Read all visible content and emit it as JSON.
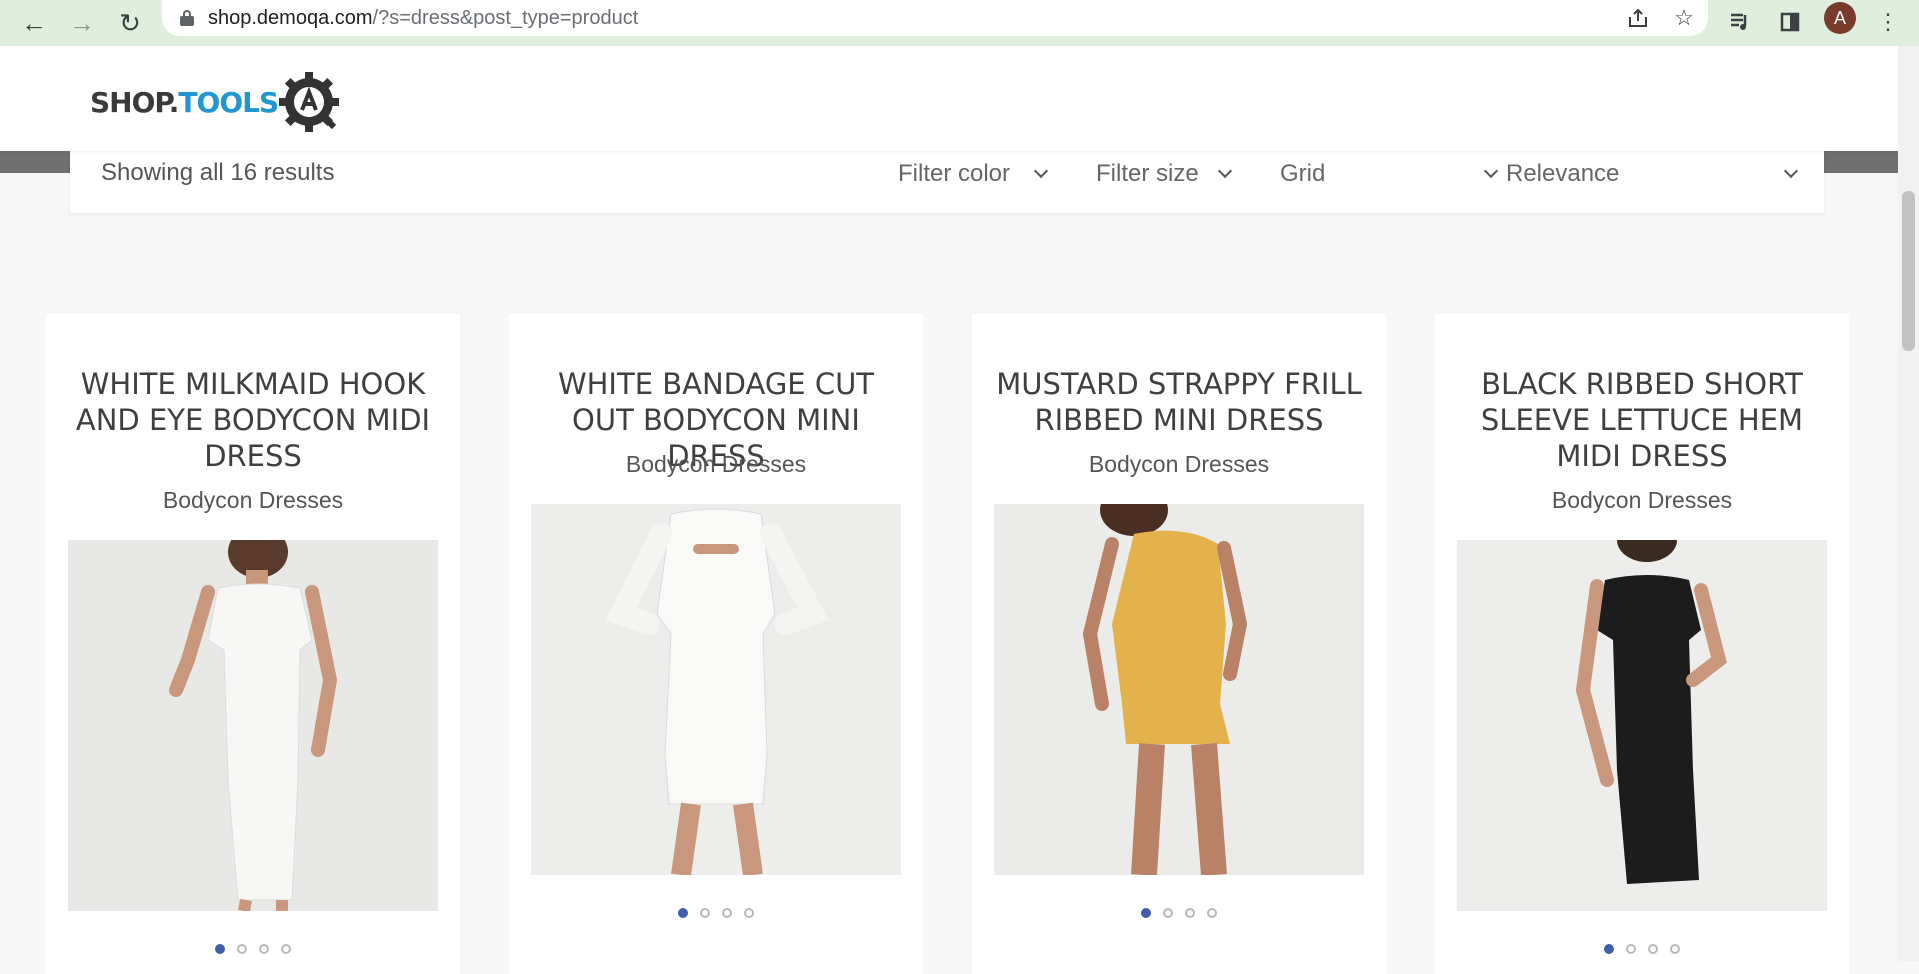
{
  "browser": {
    "url_host": "shop.demoqa.com",
    "url_path": "/?s=dress&post_type=product",
    "avatar_letter": "A",
    "icons": [
      "back-arrow-icon",
      "forward-arrow-icon",
      "reload-icon",
      "lock-icon",
      "share-icon",
      "star-icon",
      "media-icon",
      "side-panel-icon",
      "menu-icon"
    ]
  },
  "site": {
    "logo_part1": "SHOP.",
    "logo_part2": "TOOLS",
    "brand_colors": {
      "dark": "#3a3a3a",
      "accent": "#2196d3",
      "price": "#e0a63c",
      "dot_active": "#3f5ea8"
    }
  },
  "filters": {
    "results": "Showing all 16 results",
    "color": "Filter color",
    "size": "Filter size",
    "view": "Grid",
    "sort": "Relevance"
  },
  "products": [
    {
      "title": "WHITE MILKMAID HOOK AND EYE BODYCON MIDI DRESS",
      "category": "Bodycon Dresses",
      "dress_color": "#f2f2f2",
      "slides": 4,
      "active_slide": 1
    },
    {
      "title": "WHITE BANDAGE CUT OUT BODYCON MINI DRESS",
      "category": "Bodycon Dresses",
      "dress_color": "#f4f4f4",
      "slides": 4,
      "active_slide": 1
    },
    {
      "title": "MUSTARD STRAPPY FRILL RIBBED MINI DRESS",
      "category": "Bodycon Dresses",
      "dress_color": "#e3b24d",
      "slides": 4,
      "active_slide": 1
    },
    {
      "title": "BLACK RIBBED SHORT SLEEVE LETTUCE HEM MIDI DRESS",
      "category": "Bodycon Dresses",
      "dress_color": "#1c1c1c",
      "slides": 4,
      "active_slide": 1
    }
  ]
}
